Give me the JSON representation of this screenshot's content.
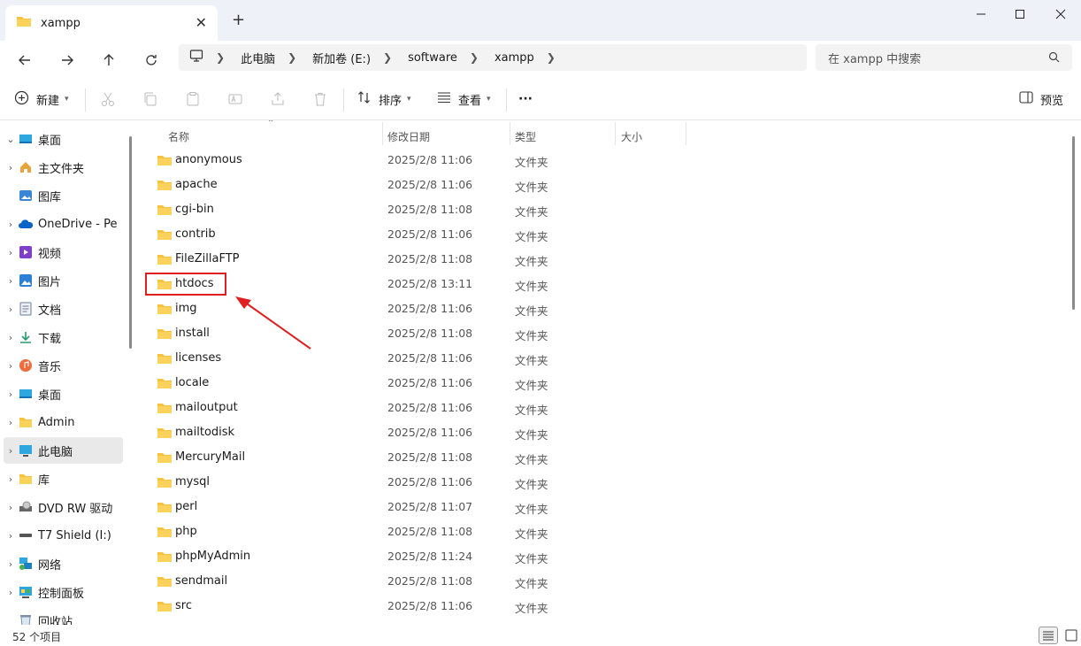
{
  "window": {
    "tab_title": "xampp",
    "new_tab_label": "+"
  },
  "nav": {
    "breadcrumbs": [
      "此电脑",
      "新加卷 (E:)",
      "software",
      "xampp"
    ],
    "search_placeholder": "在 xampp 中搜索"
  },
  "toolbar": {
    "new_label": "新建",
    "sort_label": "排序",
    "view_label": "查看",
    "more_label": "···",
    "preview_label": "预览"
  },
  "sidebar": {
    "items": [
      {
        "label": "桌面",
        "icon": "desktop-icon",
        "expanded": true
      },
      {
        "label": "主文件夹",
        "icon": "home-icon"
      },
      {
        "label": "图库",
        "icon": "gallery-icon"
      },
      {
        "label": "OneDrive - Pe",
        "icon": "onedrive-icon"
      },
      {
        "label": "视频",
        "icon": "video-icon"
      },
      {
        "label": "图片",
        "icon": "pictures-icon"
      },
      {
        "label": "文档",
        "icon": "documents-icon"
      },
      {
        "label": "下载",
        "icon": "download-icon"
      },
      {
        "label": "音乐",
        "icon": "music-icon"
      },
      {
        "label": "桌面",
        "icon": "desktop-icon"
      },
      {
        "label": "Admin",
        "icon": "folder-icon"
      },
      {
        "label": "此电脑",
        "icon": "computer-icon",
        "selected": true
      },
      {
        "label": "库",
        "icon": "library-icon"
      },
      {
        "label": "DVD RW 驱动",
        "icon": "dvd-icon"
      },
      {
        "label": "T7 Shield (I:)",
        "icon": "drive-icon"
      },
      {
        "label": "网络",
        "icon": "network-icon"
      },
      {
        "label": "控制面板",
        "icon": "control-panel-icon"
      },
      {
        "label": "回收站",
        "icon": "recycle-bin-icon"
      }
    ]
  },
  "columns": {
    "name": "名称",
    "date": "修改日期",
    "type": "类型",
    "size": "大小"
  },
  "files": [
    {
      "name": "anonymous",
      "date": "2025/2/8 11:06",
      "type": "文件夹"
    },
    {
      "name": "apache",
      "date": "2025/2/8 11:06",
      "type": "文件夹"
    },
    {
      "name": "cgi-bin",
      "date": "2025/2/8 11:08",
      "type": "文件夹"
    },
    {
      "name": "contrib",
      "date": "2025/2/8 11:06",
      "type": "文件夹"
    },
    {
      "name": "FileZillaFTP",
      "date": "2025/2/8 11:08",
      "type": "文件夹"
    },
    {
      "name": "htdocs",
      "date": "2025/2/8 13:11",
      "type": "文件夹",
      "highlighted": true
    },
    {
      "name": "img",
      "date": "2025/2/8 11:06",
      "type": "文件夹"
    },
    {
      "name": "install",
      "date": "2025/2/8 11:08",
      "type": "文件夹"
    },
    {
      "name": "licenses",
      "date": "2025/2/8 11:06",
      "type": "文件夹"
    },
    {
      "name": "locale",
      "date": "2025/2/8 11:06",
      "type": "文件夹"
    },
    {
      "name": "mailoutput",
      "date": "2025/2/8 11:06",
      "type": "文件夹"
    },
    {
      "name": "mailtodisk",
      "date": "2025/2/8 11:06",
      "type": "文件夹"
    },
    {
      "name": "MercuryMail",
      "date": "2025/2/8 11:08",
      "type": "文件夹"
    },
    {
      "name": "mysql",
      "date": "2025/2/8 11:06",
      "type": "文件夹"
    },
    {
      "name": "perl",
      "date": "2025/2/8 11:07",
      "type": "文件夹"
    },
    {
      "name": "php",
      "date": "2025/2/8 11:08",
      "type": "文件夹"
    },
    {
      "name": "phpMyAdmin",
      "date": "2025/2/8 11:24",
      "type": "文件夹"
    },
    {
      "name": "sendmail",
      "date": "2025/2/8 11:08",
      "type": "文件夹"
    },
    {
      "name": "src",
      "date": "2025/2/8 11:06",
      "type": "文件夹"
    }
  ],
  "status": {
    "item_count": "52 个项目"
  },
  "colors": {
    "folder_yellow": "#f8c23e",
    "annotation_red": "#e02020",
    "accent_blue": "#1a73c9"
  }
}
